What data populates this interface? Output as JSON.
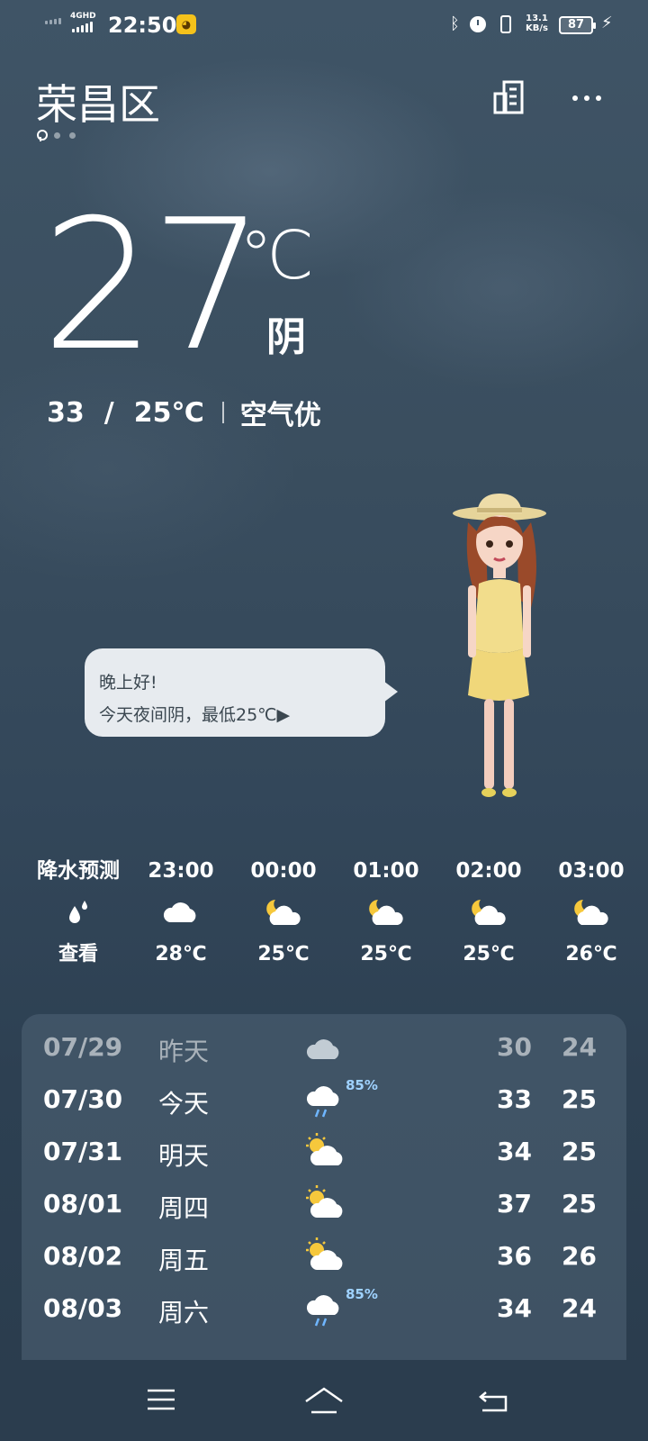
{
  "status_bar": {
    "network": "4GHD",
    "time": "22:50",
    "speed_value": "13.1",
    "speed_unit": "KB/s",
    "battery": "87",
    "icons": [
      "signal-icon",
      "bluetooth-icon",
      "alarm-icon",
      "vibrate-icon",
      "battery-icon",
      "charging-icon"
    ]
  },
  "header": {
    "city": "荣昌区",
    "pages": 3,
    "icons": [
      "location-pin-icon",
      "city-list-icon",
      "more-icon"
    ]
  },
  "current": {
    "temp": "27",
    "unit": "℃",
    "condition": "阴",
    "high": "33",
    "slash": "/",
    "low": "25℃",
    "air": "空气优"
  },
  "bubble": {
    "line1": "晚上好!",
    "line2": "今天夜间阴，最低25℃▶"
  },
  "hourly": [
    {
      "time": "降水预测",
      "icon": "raindrop-icon",
      "temp": "查看"
    },
    {
      "time": "23:00",
      "icon": "cloudy-icon",
      "temp": "28℃"
    },
    {
      "time": "00:00",
      "icon": "night-cloudy-icon",
      "temp": "25℃"
    },
    {
      "time": "01:00",
      "icon": "night-cloudy-icon",
      "temp": "25℃"
    },
    {
      "time": "02:00",
      "icon": "night-cloudy-icon",
      "temp": "25℃"
    },
    {
      "time": "03:00",
      "icon": "night-cloudy-icon",
      "temp": "26℃"
    }
  ],
  "daily": [
    {
      "date": "07/29",
      "name": "昨天",
      "icon": "cloudy-icon",
      "pop": "",
      "hi": "30",
      "lo": "24"
    },
    {
      "date": "07/30",
      "name": "今天",
      "icon": "rain-icon",
      "pop": "85%",
      "hi": "33",
      "lo": "25"
    },
    {
      "date": "07/31",
      "name": "明天",
      "icon": "partly-cloudy-icon",
      "pop": "",
      "hi": "34",
      "lo": "25"
    },
    {
      "date": "08/01",
      "name": "周四",
      "icon": "partly-cloudy-icon",
      "pop": "",
      "hi": "37",
      "lo": "25"
    },
    {
      "date": "08/02",
      "name": "周五",
      "icon": "partly-cloudy-icon",
      "pop": "",
      "hi": "36",
      "lo": "26"
    },
    {
      "date": "08/03",
      "name": "周六",
      "icon": "rain-icon",
      "pop": "85%",
      "hi": "34",
      "lo": "24"
    }
  ],
  "colors": {
    "background": "#3a4e5f",
    "card": "#506476",
    "bubble": "#e7ebef",
    "pop_text": "#9fd2ff"
  },
  "navbar": {
    "icons": [
      "menu-icon",
      "home-icon",
      "back-icon"
    ]
  }
}
